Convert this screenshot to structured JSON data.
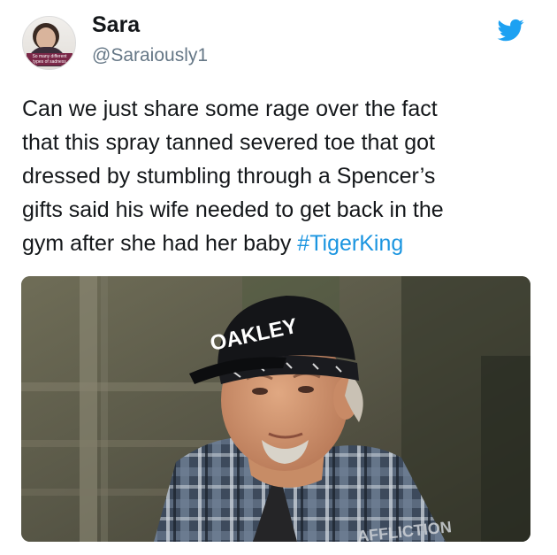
{
  "tweet": {
    "display_name": "Sara",
    "handle": "@Saraiously1",
    "avatar_caption": [
      "So many different",
      "types of sadness"
    ],
    "text_lines": [
      "Can we just share some rage over the fact",
      "that this spray tanned severed toe that got",
      "dressed by stumbling through a Spencer’s",
      "gifts said his wife needed to get back in the"
    ],
    "last_line_text": "gym after she had her baby ",
    "hashtag": "#TigerKing"
  },
  "media": {
    "cap_logo": "OAKLEY",
    "shirt_print": "AFFLICTION"
  },
  "colors": {
    "twitter_blue": "#1da1f2",
    "hashtag": "#1b95e0",
    "handle_gray": "#657786",
    "text": "#14171a"
  },
  "icons": {
    "brand": "twitter-bird-icon"
  }
}
